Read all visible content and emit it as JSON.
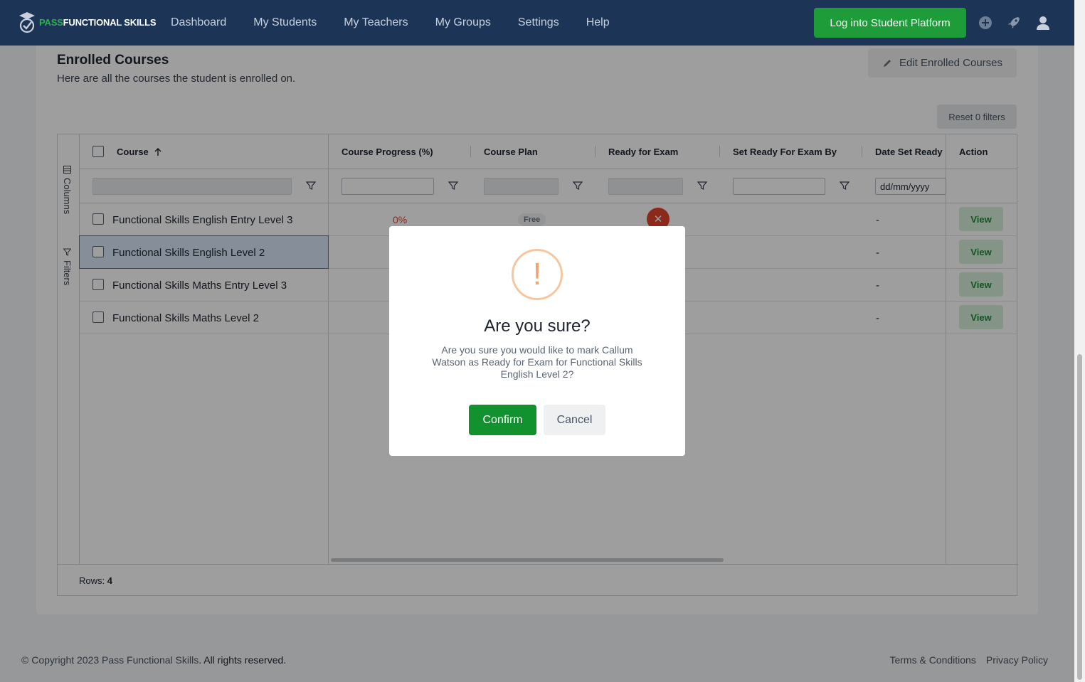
{
  "nav": {
    "logo_pass": "PASS",
    "logo_rest": "FUNCTIONAL SKILLS",
    "items": [
      "Dashboard",
      "My Students",
      "My Teachers",
      "My Groups",
      "Settings",
      "Help"
    ],
    "login_label": "Log into Student Platform"
  },
  "section": {
    "title": "Enrolled Courses",
    "subtitle": "Here are all the courses the student is enrolled on.",
    "edit_label": "Edit Enrolled Courses",
    "reset_label": "Reset 0 filters"
  },
  "grid": {
    "side_tabs": [
      "Columns",
      "Filters"
    ],
    "columns": [
      "Course",
      "Course Progress (%)",
      "Course Plan",
      "Ready for Exam",
      "Set Ready For Exam By",
      "Date Set Ready",
      "Action"
    ],
    "date_placeholder": "dd/mm/yyyy",
    "rows": [
      {
        "course": "Functional Skills English Entry Level 3",
        "progress": "0%",
        "plan": "Free",
        "date": "-",
        "action": "View"
      },
      {
        "course": "Functional Skills English Level 2",
        "date": "-",
        "action": "View"
      },
      {
        "course": "Functional Skills Maths Entry Level 3",
        "date": "-",
        "action": "View"
      },
      {
        "course": "Functional Skills Maths Level 2",
        "date": "-",
        "action": "View"
      }
    ],
    "rows_label": "Rows:",
    "rows_count": "4"
  },
  "footer": {
    "copyright_prefix": "© Copyright 2023 ",
    "brand": "Pass Functional Skills",
    "copyright_suffix": ". All rights reserved.",
    "terms": "Terms & Conditions",
    "privacy": "Privacy Policy"
  },
  "modal": {
    "icon": "!",
    "title": "Are you sure?",
    "text": "Are you sure you would like to mark Callum Watson as Ready for Exam for Functional Skills English Level 2?",
    "confirm": "Confirm",
    "cancel": "Cancel"
  },
  "colors": {
    "nav_bg": "#1c3557",
    "brand_green": "#1f9c3a",
    "danger": "#e0452d",
    "warning": "#f3a46c"
  }
}
